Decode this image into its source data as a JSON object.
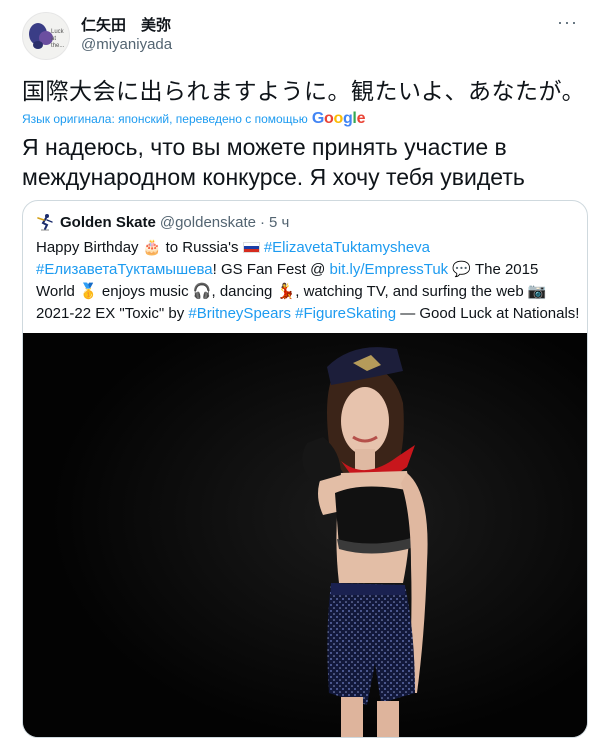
{
  "author": {
    "display_name": "仁矢田　美弥",
    "handle": "@miyaniyada",
    "avatar_signature": "Luck at the..."
  },
  "more_icon": "more-dots-icon",
  "tweet_text": "国際大会に出られますように。観たいよ、あなたが。",
  "translation": {
    "label": "Язык оригинала: японский, переведено с помощью",
    "google_letters": [
      "G",
      "o",
      "o",
      "g",
      "l",
      "e"
    ],
    "text": "Я надеюсь, что вы можете принять участие в международном конкурсе. Я хочу тебя увидеть"
  },
  "quote": {
    "name": "Golden Skate",
    "handle": "@goldenskate",
    "dot": "·",
    "time": "5 ч",
    "segments": {
      "s1": "Happy Birthday ",
      "e1": "🎂",
      "s2": " to Russia's ",
      "h1": "#ElizavetaTuktamysheva",
      "h2": "#ЕлизаветаТуктамышева",
      "s3": "! GS Fan Fest @ ",
      "l1": "bit.ly/EmpressTuk",
      "e2": "💬",
      "s4": " The 2015 World ",
      "e3": "🥇",
      "s5": " enjoys music ",
      "e4": "🎧",
      "s6": ", dancing ",
      "e5": "💃",
      "s7": ", watching TV, and surfing the web ",
      "e6": "📷",
      "s8": " 2021-22 EX \"Toxic\" by ",
      "h3": "#BritneySpears",
      "h4": "#FigureSkating",
      "s9": " — Good Luck at Nationals!"
    }
  },
  "colors": {
    "link": "#1d9bf0",
    "text": "#0f1419",
    "muted": "#536471",
    "border": "#cfd9de",
    "photo_bg": "#050505"
  }
}
